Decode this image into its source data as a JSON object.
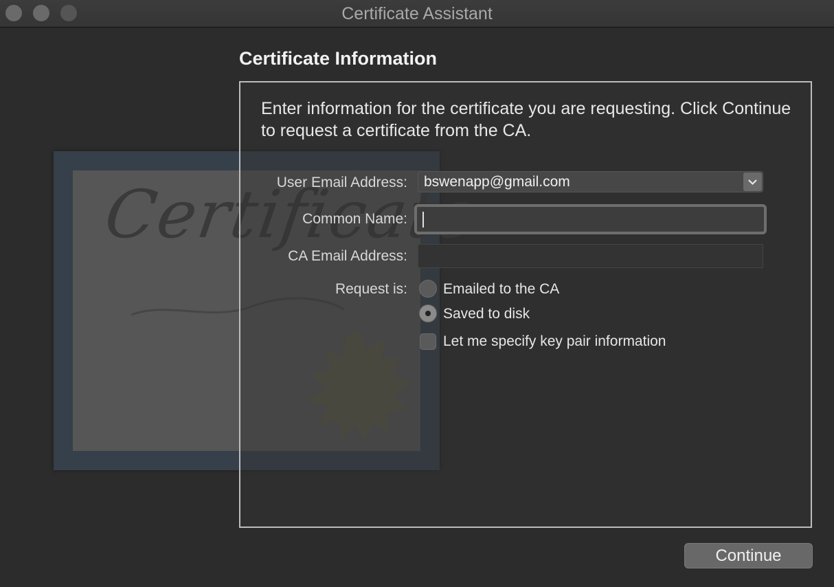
{
  "window": {
    "title": "Certificate Assistant"
  },
  "illustration": {
    "word": "Certificate"
  },
  "page": {
    "heading": "Certificate Information",
    "intro": "Enter information for the certificate you are requesting. Click Continue to request a certificate from the CA."
  },
  "form": {
    "user_email_label": "User Email Address:",
    "user_email_value": "bswenapp@gmail.com",
    "common_name_label": "Common Name:",
    "common_name_value": "",
    "ca_email_label": "CA Email Address:",
    "ca_email_value": "",
    "request_label": "Request is:",
    "request_options": [
      {
        "label": "Emailed to the CA",
        "selected": false
      },
      {
        "label": "Saved to disk",
        "selected": true
      }
    ],
    "key_pair_label": "Let me specify key pair information",
    "key_pair_checked": false
  },
  "buttons": {
    "continue": "Continue"
  }
}
